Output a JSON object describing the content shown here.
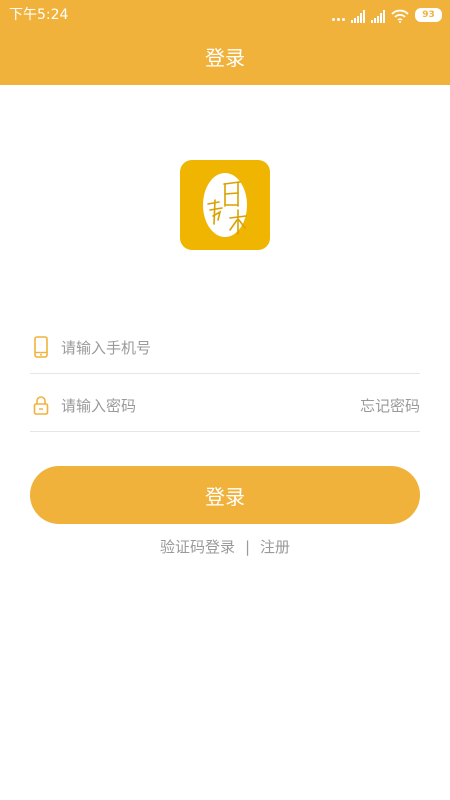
{
  "status_bar": {
    "time": "下午5:24",
    "battery": "93"
  },
  "header": {
    "title": "登录"
  },
  "logo": {
    "icon": "app-logo-icon",
    "color": "#f0b500"
  },
  "form": {
    "phone": {
      "icon": "phone-icon",
      "placeholder": "请输入手机号",
      "value": ""
    },
    "password": {
      "icon": "lock-icon",
      "placeholder": "请输入密码",
      "value": "",
      "forgot_label": "忘记密码"
    },
    "login_label": "登录"
  },
  "links": {
    "sms_login": "验证码登录",
    "separator": "|",
    "register": "注册"
  },
  "colors": {
    "accent": "#f0b23a",
    "placeholder": "#9a9a9a",
    "divider": "#e6e6e6"
  }
}
